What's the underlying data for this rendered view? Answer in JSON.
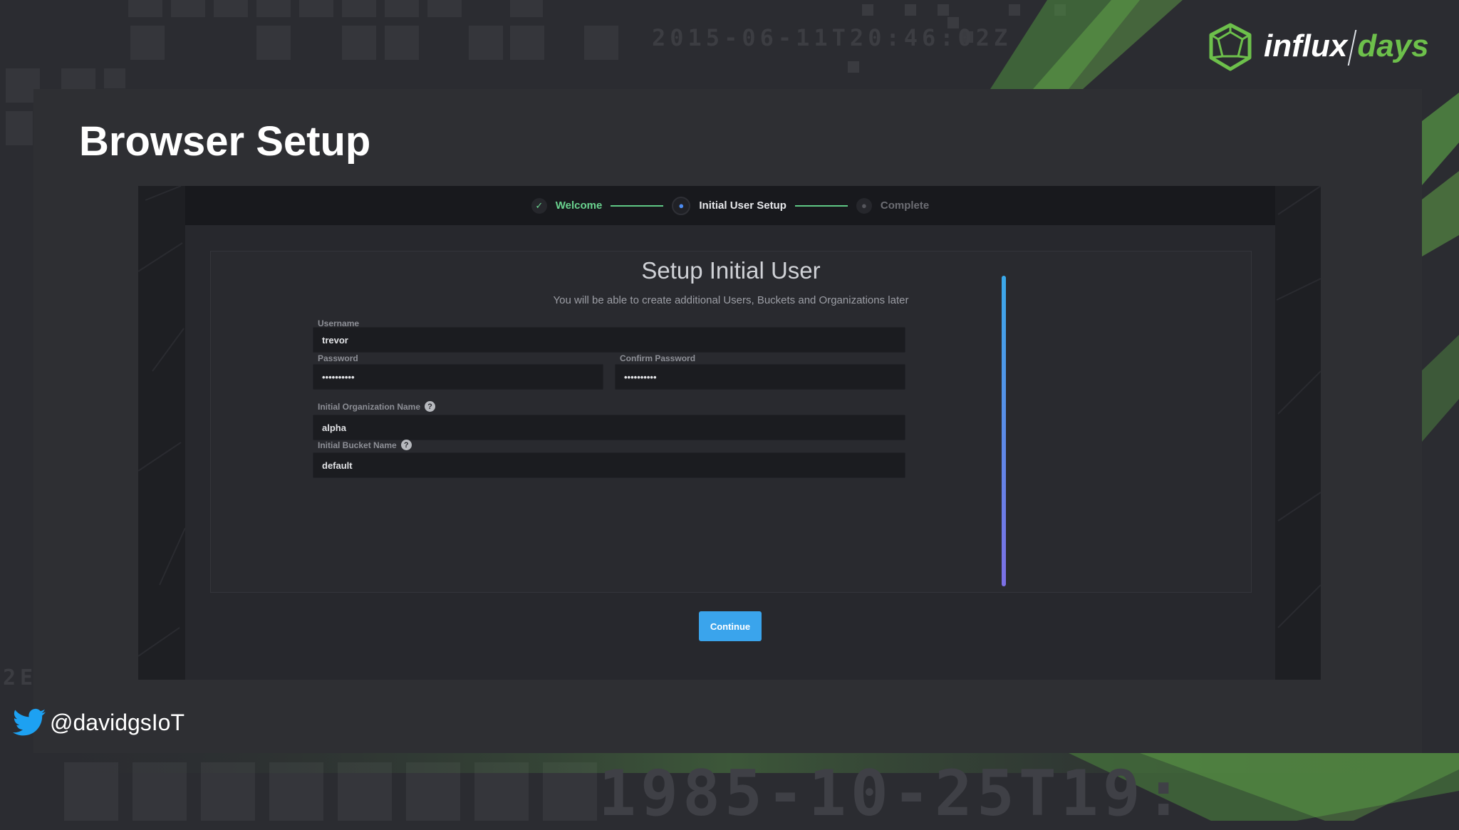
{
  "background": {
    "top_stamp": "2015-06-11T20:46:02Z",
    "bottom_stamp": "1985-10-25T19:",
    "left_stamp": "2E"
  },
  "logo": {
    "word1": "influx",
    "word2": "days"
  },
  "slide": {
    "title": "Browser Setup"
  },
  "stepper": {
    "steps": [
      {
        "label": "Welcome",
        "state": "done"
      },
      {
        "label": "Initial User Setup",
        "state": "active"
      },
      {
        "label": "Complete",
        "state": "pending"
      }
    ]
  },
  "form": {
    "title": "Setup Initial User",
    "subtitle": "You will be able to create additional Users, Buckets and Organizations later",
    "username": {
      "label": "Username",
      "value": "trevor"
    },
    "password": {
      "label": "Password",
      "value": "••••••••••"
    },
    "confirm_password": {
      "label": "Confirm Password",
      "value": "••••••••••"
    },
    "org": {
      "label": "Initial Organization Name",
      "value": "alpha"
    },
    "bucket": {
      "label": "Initial Bucket Name",
      "value": "default"
    },
    "continue_label": "Continue"
  },
  "footer": {
    "twitter_handle": "@davidgsIoT"
  },
  "colors": {
    "accent_green": "#6ad38f",
    "accent_blue": "#3aa4ec",
    "brand_green": "#6dc04b"
  }
}
